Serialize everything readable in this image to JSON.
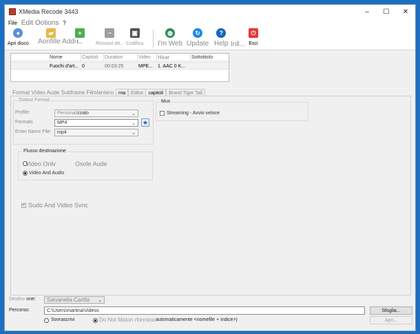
{
  "window": {
    "title": "XMedia Recode 3443"
  },
  "menu": [
    "File",
    "Edit Ootions",
    "?"
  ],
  "toolbar": {
    "open_disc": "Apri disco",
    "add_file": "Aonfille Addi",
    "add_file_suffix": "l...",
    "remove": "Rimuovi att...",
    "encode": "Codifica",
    "web": "I'm Web",
    "update": "Update",
    "help": "Help",
    "info": "Inll...",
    "exit": "Esci"
  },
  "file_table": {
    "headers": [
      "Nome",
      "Capitoli",
      "Duration",
      "Video",
      "Hear",
      "Sottotitolo"
    ],
    "rows": [
      [
        "Fuochi d'art...",
        "0",
        "00:03:25",
        "MPE...",
        "1. AAC 0 K...",
        ""
      ]
    ]
  },
  "tabs": [
    "Format Video Aude Subframe Filmlantero",
    "rna",
    "Editor",
    "capitoli",
    "Brand Tiger Tail"
  ],
  "output_format": {
    "legend": "Outout Format",
    "profile_label": "Profile:",
    "profile_value": "Personali",
    "profile_value_suffix": "zzato",
    "formats_label": "Formats",
    "formats_value": "MP4",
    "extension_label": "Enter Name File:",
    "extension_value": "mp4"
  },
  "mux": {
    "legend": "Mux",
    "streaming_label": "Streaming - Avvio veloce"
  },
  "stream": {
    "legend": "Flusso destinazione",
    "video_only": "Video Onlv",
    "audio_only": "Osole Aude",
    "video_audio": "Video And Audio"
  },
  "sync_label": "Sudo And Video Svnc",
  "destination": {
    "label": "Destinv",
    "label_suffix": "one:",
    "value": "Salvanella Cartlla",
    "path_label": "Percorso:",
    "path_value": "C:\\Users\\martina\\Videos",
    "browse": "Sfoglia...",
    "overwrite": "Sovrascrivi",
    "no_overwrite": "Do Not Maton rformina",
    "no_overwrite_suffix": "automaticamente <nomefile + indice>)",
    "open": "Apri..."
  },
  "colors": {
    "desktop": "#1e6fbf",
    "open_disc_icon": "#5b8fd6",
    "add_icon": "#4caf50",
    "remove_icon": "#9e9e9e",
    "web_icon": "#2e8b57",
    "update_icon": "#1e88e5",
    "help_icon": "#1565c0",
    "exit_icon": "#e53935"
  }
}
